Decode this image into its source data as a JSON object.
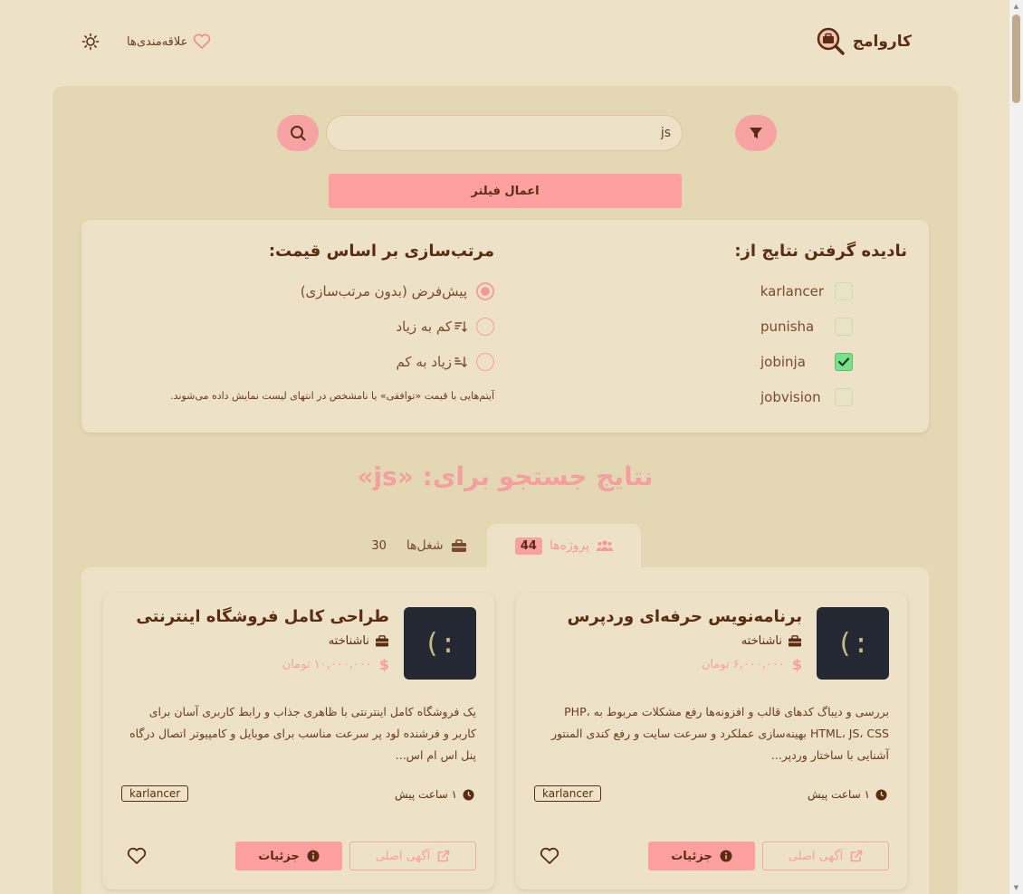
{
  "header": {
    "brand_name": "کاروامج",
    "favorites_label": "علاقه‌مندی‌ها"
  },
  "search": {
    "value": "js",
    "apply_label": "اعمال فیلتر"
  },
  "filters": {
    "ignore_title": "نادیده گرفتن نتایج از:",
    "sources": [
      {
        "label": "karlancer",
        "checked": false
      },
      {
        "label": "punisha",
        "checked": false
      },
      {
        "label": "jobinja",
        "checked": true
      },
      {
        "label": "jobvision",
        "checked": false
      }
    ],
    "sort_title": "مرتب‌سازی بر اساس قیمت:",
    "sort_options": [
      {
        "label": "پیش‌فرض (بدون مرتب‌سازی)",
        "selected": true
      },
      {
        "label": "کم به زیاد",
        "selected": false
      },
      {
        "label": "زیاد به کم",
        "selected": false
      }
    ],
    "sort_note": "آیتم‌هایی با قیمت «توافقی» یا نامشخص در انتهای لیست نمایش داده می‌شوند."
  },
  "results": {
    "title": "نتایج جستجو برای: «js»",
    "tabs": [
      {
        "label": "پروژه‌ها",
        "count": "44",
        "active": true
      },
      {
        "label": "شغل‌ها",
        "count": "30",
        "active": false
      }
    ]
  },
  "cards": [
    {
      "logo_text": ":)",
      "title": "برنامه‌نویس حرفه‌ای وردپرس",
      "company": "ناشناخته",
      "price": "۶,۰۰۰,۰۰۰ تومان",
      "description": "بررسی و دیباگ کدهای قالب و افزونه‌ها رفع مشکلات مربوط به PHP، HTML، JS، CSS بهینه‌سازی عملکرد و سرعت سایت و رفع کندی المنتور آشنایی با ساختار وردپر...",
      "time": "۱ ساعت پیش",
      "source": "karlancer",
      "details_label": "جزئیات",
      "original_label": "آگهی اصلی"
    },
    {
      "logo_text": ":)",
      "title": "طراحی کامل فروشگاه اینترنتی",
      "company": "ناشناخته",
      "price": "۱۰,۰۰۰,۰۰۰ تومان",
      "description": "یک فروشگاه کامل اینترنتی با ظاهری جذاب و رابط کاربری آسان برای کاربر و فرشنده لود پر سرعت مناسب برای موبایل و کامپیوتر اتصال درگاه پنل اس ام اس...",
      "time": "۱ ساعت پیش",
      "source": "karlancer",
      "details_label": "جزئیات",
      "original_label": "آگهی اصلی"
    }
  ],
  "colors": {
    "background": "#ede2c8",
    "panel": "#e4d8b4",
    "accent": "#ffa0a0",
    "text": "#5a2d12",
    "logo_bg": "#232833"
  }
}
